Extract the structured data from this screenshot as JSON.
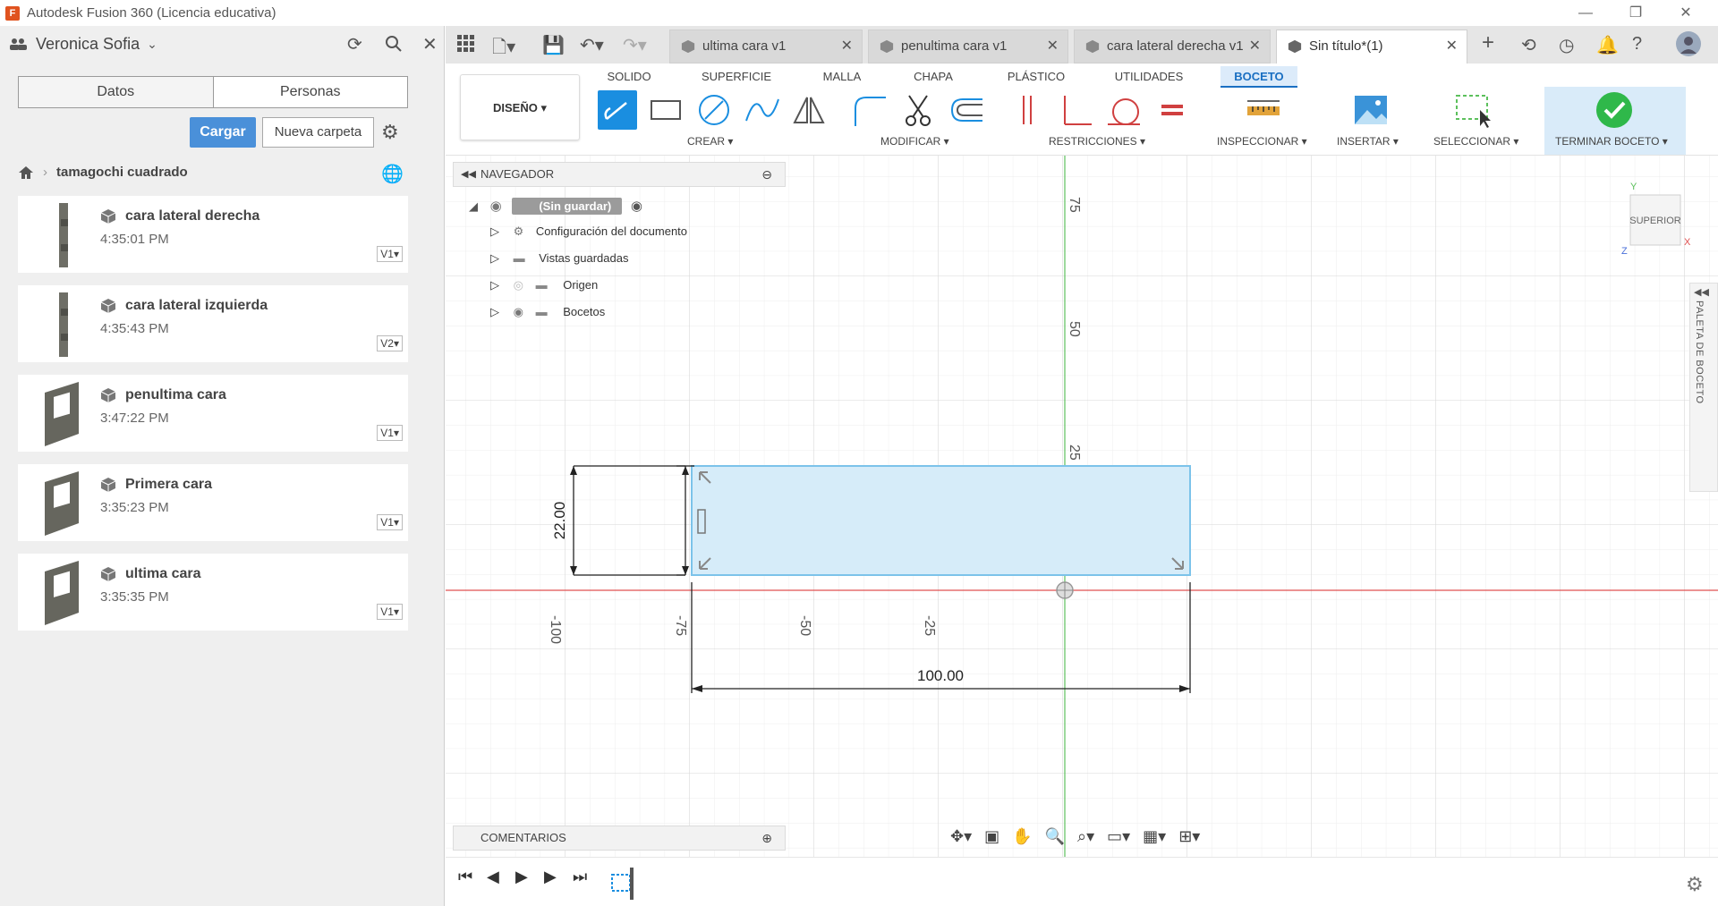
{
  "window": {
    "title": "Autodesk Fusion 360 (Licencia educativa)",
    "app_icon_letter": "F",
    "minimize": "—",
    "restore": "❐",
    "close": "✕"
  },
  "data_panel": {
    "user_name": "Veronica Sofia",
    "tabs": [
      "Datos",
      "Personas"
    ],
    "upload_label": "Cargar",
    "new_folder_label": "Nueva carpeta",
    "breadcrumb_folder": "tamagochi cuadrado",
    "files": [
      {
        "name": "cara lateral derecha",
        "time": "4:35:01 PM",
        "version": "V1▾"
      },
      {
        "name": "cara lateral izquierda",
        "time": "4:35:43 PM",
        "version": "V2▾"
      },
      {
        "name": "penultima cara",
        "time": "3:47:22 PM",
        "version": "V1▾"
      },
      {
        "name": "Primera cara",
        "time": "3:35:23 PM",
        "version": "V1▾"
      },
      {
        "name": "ultima cara",
        "time": "3:35:35 PM",
        "version": "V1▾"
      }
    ]
  },
  "doc_tabs": [
    {
      "label": "ultima cara v1"
    },
    {
      "label": "penultima cara v1"
    },
    {
      "label": "cara lateral derecha v1"
    },
    {
      "label": "Sin título*(1)"
    }
  ],
  "toolbar": {
    "workspace": "DISEÑO ▾",
    "tabs": [
      "SOLIDO",
      "SUPERFICIE",
      "MALLA",
      "CHAPA",
      "PLÁSTICO",
      "UTILIDADES",
      "BOCETO"
    ],
    "groups": [
      "CREAR ▾",
      "MODIFICAR ▾",
      "RESTRICCIONES ▾",
      "INSPECCIONAR ▾",
      "INSERTAR ▾",
      "SELECCIONAR ▾",
      "TERMINAR BOCETO ▾"
    ]
  },
  "navigator": {
    "title": "NAVEGADOR",
    "root": "(Sin guardar)",
    "items": [
      "Configuración del documento",
      "Vistas guardadas",
      "Origen",
      "Bocetos"
    ]
  },
  "comments_label": "COMENTARIOS",
  "viewcube": {
    "face": "SUPERIOR",
    "x": "X",
    "y": "Y",
    "z": "Z"
  },
  "palette_label": "PALETA DE BOCETO",
  "sketch": {
    "height_dim": "22.00",
    "width_dim": "100.00",
    "axis_ticks_x": [
      "-100",
      "-75",
      "-50",
      "-25"
    ],
    "axis_ticks_y": [
      "75",
      "50",
      "25"
    ]
  },
  "colors": {
    "accent": "#1a8ee0",
    "x_axis": "#e05050",
    "y_axis": "#5cc05c",
    "sketch_fill": "#d6ecf9",
    "sketch_edge": "#7cc3ea",
    "finish": "#2fb84a"
  }
}
